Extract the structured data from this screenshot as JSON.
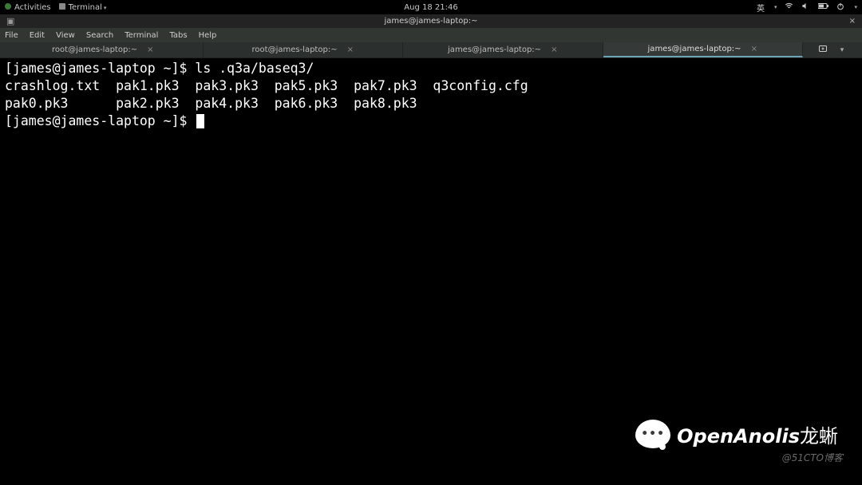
{
  "gnome_panel": {
    "activities": "Activities",
    "app_label": "Terminal",
    "clock": "Aug 18  21:46",
    "ime": "英",
    "icons": [
      "network-icon",
      "volume-icon",
      "battery-icon",
      "power-icon"
    ]
  },
  "window": {
    "title": "james@james-laptop:~",
    "left_icon": "terminal-icon"
  },
  "menubar": [
    "File",
    "Edit",
    "View",
    "Search",
    "Terminal",
    "Tabs",
    "Help"
  ],
  "tabs": {
    "items": [
      {
        "label": "root@james-laptop:~",
        "active": false
      },
      {
        "label": "root@james-laptop:~",
        "active": false
      },
      {
        "label": "james@james-laptop:~",
        "active": false
      },
      {
        "label": "james@james-laptop:~",
        "active": true
      }
    ],
    "new_tab_icon": "new-tab-icon",
    "menu_icon": "chevron-down-icon"
  },
  "terminal": {
    "lines": [
      {
        "prompt": "[james@james-laptop ~]$ ",
        "cmd": "ls .q3a/baseq3/"
      },
      {
        "text": "crashlog.txt  pak1.pk3  pak3.pk3  pak5.pk3  pak7.pk3  q3config.cfg"
      },
      {
        "text": "pak0.pk3      pak2.pk3  pak4.pk3  pak6.pk3  pak8.pk3"
      },
      {
        "prompt": "[james@james-laptop ~]$ ",
        "cmd": "",
        "cursor": true
      }
    ]
  },
  "watermark": {
    "brand": "OpenAnolis",
    "brand_cn": "龙蜥",
    "sub": "@51CTO博客"
  }
}
